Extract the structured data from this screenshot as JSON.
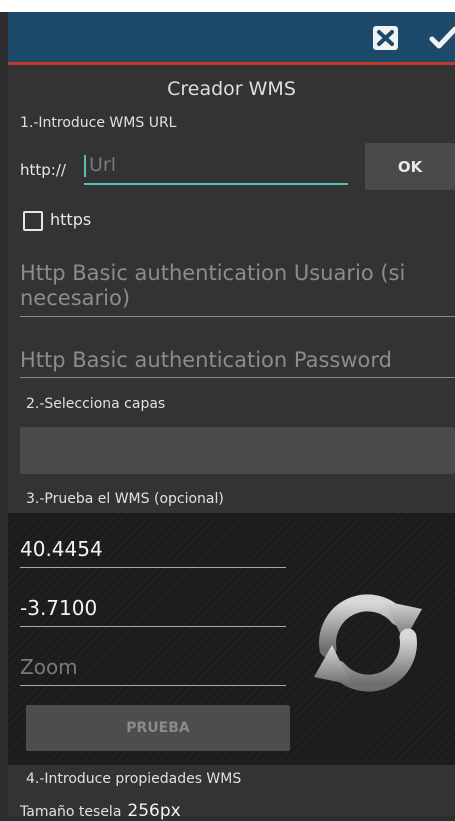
{
  "toolbar": {
    "close_icon": "close-box-icon",
    "confirm_icon": "check-icon"
  },
  "dialog_title": "Creador WMS",
  "step1": {
    "label": "1.-Introduce WMS URL",
    "prefix": "http://",
    "url_placeholder": "Url",
    "url_value": "",
    "ok_label": "OK",
    "https_label": "https",
    "https_checked": false
  },
  "auth": {
    "user_placeholder": "Http Basic authentication Usuario (si necesario)",
    "password_placeholder": "Http Basic authentication Password"
  },
  "step2": {
    "label": "2.-Selecciona capas",
    "selected_layer": ""
  },
  "step3": {
    "label": "3.-Prueba el WMS (opcional)",
    "latitude": "40.4454",
    "longitude": "-3.7100",
    "zoom_placeholder": "Zoom",
    "test_label": "PRUEBA",
    "refresh_icon": "refresh-icon"
  },
  "step4": {
    "label": "4.-Introduce propiedades WMS",
    "tile_size_label": "Tamaño tesela",
    "tile_size_value": "256px"
  }
}
